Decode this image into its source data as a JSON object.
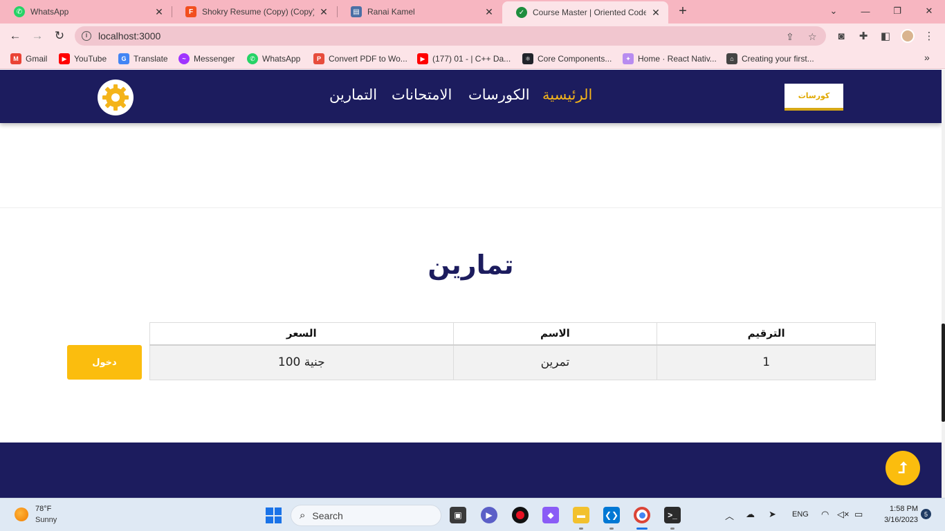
{
  "browser": {
    "tabs": [
      {
        "title": "WhatsApp",
        "icon": "whatsapp-icon",
        "color": "#25d366",
        "active": false
      },
      {
        "title": "Shokry Resume (Copy) (Copy) – F",
        "icon": "figma-icon",
        "color": "#f24e1e",
        "active": false
      },
      {
        "title": "Ranai Kamel",
        "icon": "document-icon",
        "color": "#4a6fa5",
        "active": false
      },
      {
        "title": "Course Master | Oriented Coders",
        "icon": "check-circle-icon",
        "color": "#1e8e3e",
        "active": true
      }
    ],
    "close_glyph": "✕",
    "new_tab_glyph": "+",
    "url": "localhost:3000",
    "bookmarks": [
      {
        "label": "Gmail",
        "icon": "gmail-icon",
        "color": "#ea4335"
      },
      {
        "label": "YouTube",
        "icon": "youtube-icon",
        "color": "#ff0000"
      },
      {
        "label": "Translate",
        "icon": "translate-icon",
        "color": "#4285f4"
      },
      {
        "label": "Messenger",
        "icon": "messenger-icon",
        "color": "#a033ff"
      },
      {
        "label": "WhatsApp",
        "icon": "whatsapp-icon",
        "color": "#25d366"
      },
      {
        "label": "Convert PDF to Wo...",
        "icon": "pdf-converter-icon",
        "color": "#e74c3c"
      },
      {
        "label": "(177) 01 - | C++ Da...",
        "icon": "youtube-icon",
        "color": "#ff0000"
      },
      {
        "label": "Core Components...",
        "icon": "react-icon",
        "color": "#20232a"
      },
      {
        "label": "Home · React Nativ...",
        "icon": "expo-icon",
        "color": "#b88cf0"
      },
      {
        "label": "Creating your first...",
        "icon": "school-icon",
        "color": "#444444"
      }
    ]
  },
  "site": {
    "nav": [
      {
        "label": "الرئيسية",
        "active": true
      },
      {
        "label": "الكورسات",
        "active": false
      },
      {
        "label": "الامتحانات",
        "active": false
      },
      {
        "label": "التمارين",
        "active": false
      }
    ],
    "logo_text": "كورسات",
    "section_title": "تمارين",
    "table": {
      "headers": {
        "number": "الترقيم",
        "name": "الاسم",
        "price": "السعر"
      },
      "rows": [
        {
          "number": "1",
          "name": "تمرين",
          "price": "100 جنية"
        }
      ]
    },
    "enter_button": "دخول",
    "colors": {
      "primary": "#1c1c5e",
      "accent": "#fbbd0e",
      "active_nav": "#f4b41a"
    }
  },
  "taskbar": {
    "weather_temp": "78°F",
    "weather_desc": "Sunny",
    "search_label": "Search",
    "language": "ENG",
    "time": "1:58 PM",
    "date": "3/16/2023",
    "notifications": "5"
  }
}
